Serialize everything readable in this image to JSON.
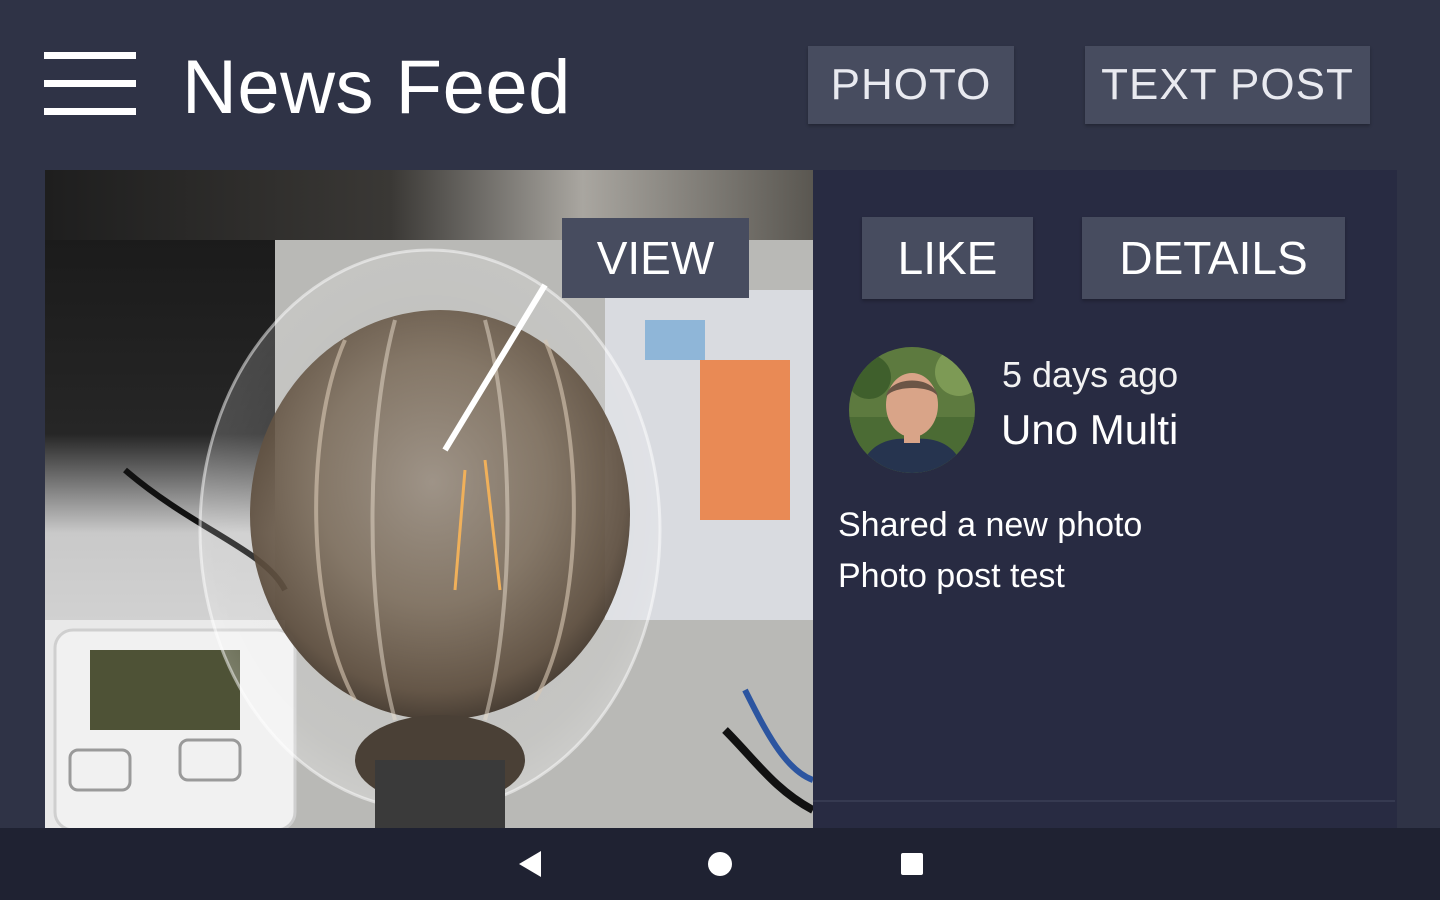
{
  "appbar": {
    "menu_icon": "hamburger-menu-icon",
    "title": "News Feed",
    "photo_label": "PHOTO",
    "text_post_label": "TEXT POST"
  },
  "post": {
    "view_label": "VIEW",
    "like_label": "LIKE",
    "details_label": "DETAILS",
    "timestamp": "5 days ago",
    "author": "Uno Multi",
    "line1": "Shared a new photo",
    "line2": "Photo post test"
  },
  "navbar": {
    "back_icon": "back-triangle-icon",
    "home_icon": "home-circle-icon",
    "recents_icon": "recents-square-icon"
  },
  "colors": {
    "background": "#2f3346",
    "card": "#282b42",
    "button": "#474c5f",
    "navbar": "#1f2232"
  }
}
